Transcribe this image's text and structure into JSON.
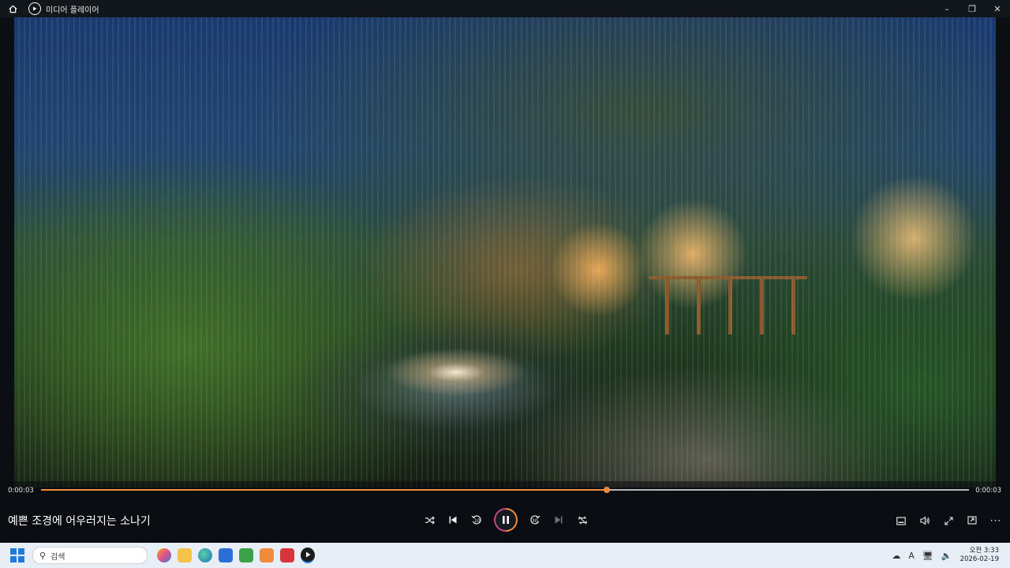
{
  "window": {
    "title": "미디어 플레이어",
    "home_icon": "home-icon",
    "app_icon": "media-player-icon",
    "controls": [
      "minimize-icon",
      "restore-icon",
      "close-icon"
    ]
  },
  "player": {
    "current_time": "0:00:03",
    "total_time": "0:00:03",
    "progress": 0.61,
    "media_title": "예쁜 조경에 어우러지는 소나기",
    "accent_color": "#f08a3c",
    "state": "playing"
  },
  "buttons": {
    "shuffle": "shuffle-icon",
    "previous": "previous-icon",
    "skip_back": "10",
    "pause": "pause-icon",
    "skip_forward": "30",
    "next": "next-icon",
    "repeat": "repeat-off-icon",
    "subtitles": "subtitles-icon",
    "volume": "volume-icon",
    "fullscreen": "fullscreen-icon",
    "miniplayer": "miniplayer-icon",
    "more": "more-icon"
  },
  "taskbar": {
    "search_placeholder": "검색",
    "apps": [
      "copilot-icon",
      "file-explorer-icon",
      "edge-icon",
      "store-icon",
      "app-icon-1",
      "app-icon-2",
      "app-icon-3",
      "media-player-icon"
    ],
    "tray": {
      "input_indicator": "A",
      "time": "오전 3:33",
      "date": "2026-02-19"
    }
  }
}
